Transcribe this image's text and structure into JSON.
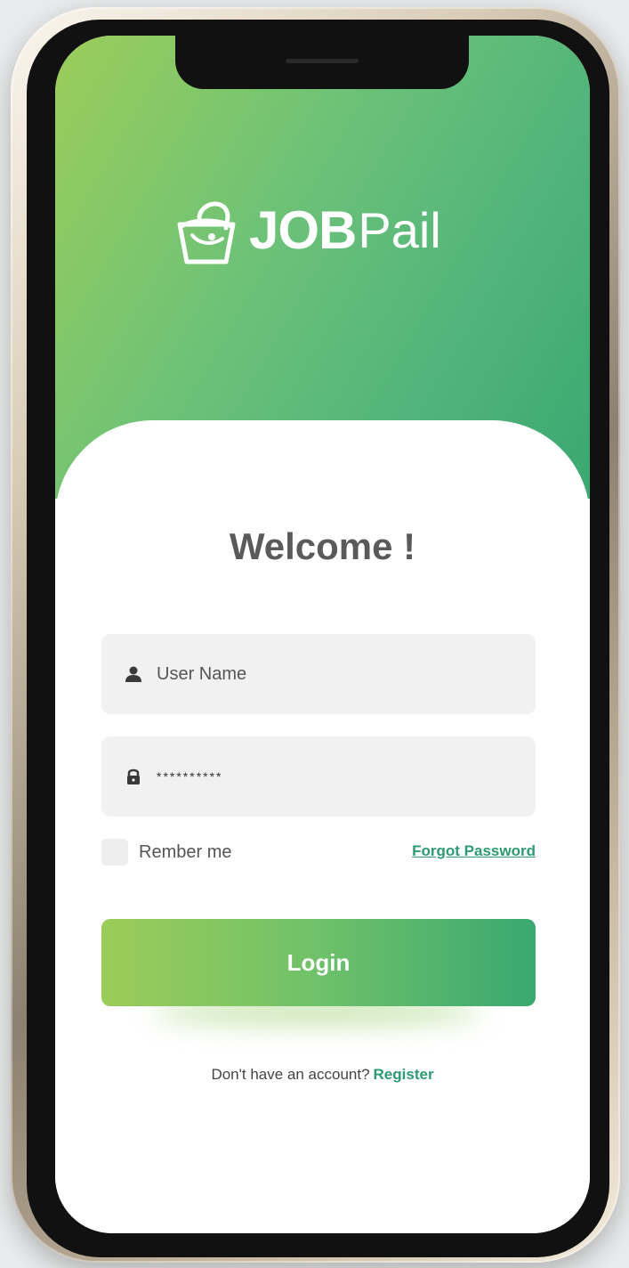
{
  "app": {
    "logo_bold": "JOB",
    "logo_light": "Pail"
  },
  "login": {
    "welcome": "Welcome !",
    "username_placeholder": "User Name",
    "password_value": "**********",
    "remember_label": "Rember me",
    "forgot_label": "Forgot Password",
    "login_label": "Login",
    "register_prompt": "Don't have an account?",
    "register_label": "Register"
  },
  "icons": {
    "logo": "bucket-icon",
    "username": "user-icon",
    "password": "lock-icon"
  },
  "colors": {
    "brand_green": "#3aa870",
    "brand_lime": "#9ccd59",
    "link_green": "#2e9a72",
    "welcome_text": "#5a5a5a",
    "field_bg": "#f1f1f1"
  }
}
